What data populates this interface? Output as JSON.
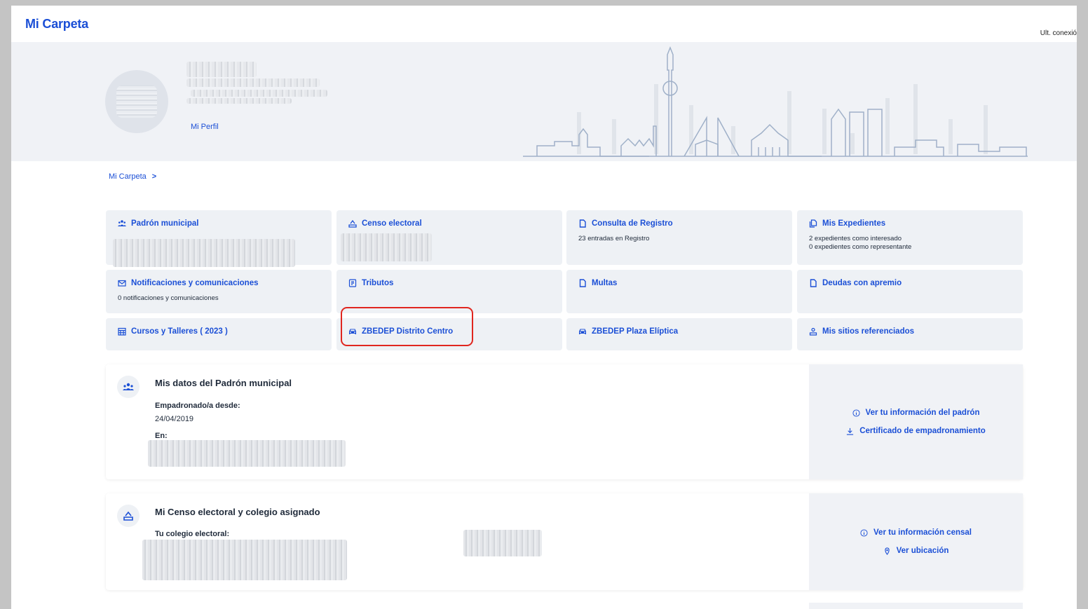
{
  "header": {
    "app_title": "Mi Carpeta",
    "last_connection": "Ult. conexió"
  },
  "profile": {
    "link": "Mi Perfil"
  },
  "breadcrumb": {
    "root": "Mi Carpeta",
    "chevron": ">"
  },
  "cards": [
    {
      "label": "Padrón municipal",
      "icon": "people-icon",
      "sub": ""
    },
    {
      "label": "Censo electoral",
      "icon": "ballot-icon",
      "sub": ""
    },
    {
      "label": "Consulta de Registro",
      "icon": "document-icon",
      "sub": "23 entradas en Registro"
    },
    {
      "label": "Mis Expedientes",
      "icon": "files-icon",
      "sub": "2 expedientes como interesado",
      "sub2": "0 expedientes como representante"
    },
    {
      "label": "Notificaciones y comunicaciones",
      "icon": "mail-icon",
      "sub": "0 notificaciones y comunicaciones"
    },
    {
      "label": "Tributos",
      "icon": "receipt-icon",
      "sub": ""
    },
    {
      "label": "Multas",
      "icon": "document-icon",
      "sub": ""
    },
    {
      "label": "Deudas con apremio",
      "icon": "document-icon",
      "sub": ""
    },
    {
      "label": "Cursos y Talleres ( 2023 )",
      "icon": "calendar-icon",
      "sub": ""
    },
    {
      "label": "ZBEDEP Distrito Centro",
      "icon": "car-icon",
      "sub": ""
    },
    {
      "label": "ZBEDEP Plaza Elíptica",
      "icon": "car-icon",
      "sub": ""
    },
    {
      "label": "Mis sitios referenciados",
      "icon": "location-user-icon",
      "sub": ""
    }
  ],
  "padron_section": {
    "title": "Mis datos del Padrón municipal",
    "since_label": "Empadronado/a desde:",
    "since_value": "24/04/2019",
    "in_label": "En:",
    "links": [
      "Ver tu información del padrón",
      "Certificado de empadronamiento"
    ]
  },
  "censo_section": {
    "title": "Mi Censo electoral y colegio asignado",
    "college_label": "Tu colegio electoral:",
    "links": [
      "Ver tu información censal",
      "Ver ubicación"
    ]
  },
  "colors": {
    "accent": "#1b4fd6",
    "card_bg": "#eef1f5",
    "highlight": "#e0261f"
  }
}
